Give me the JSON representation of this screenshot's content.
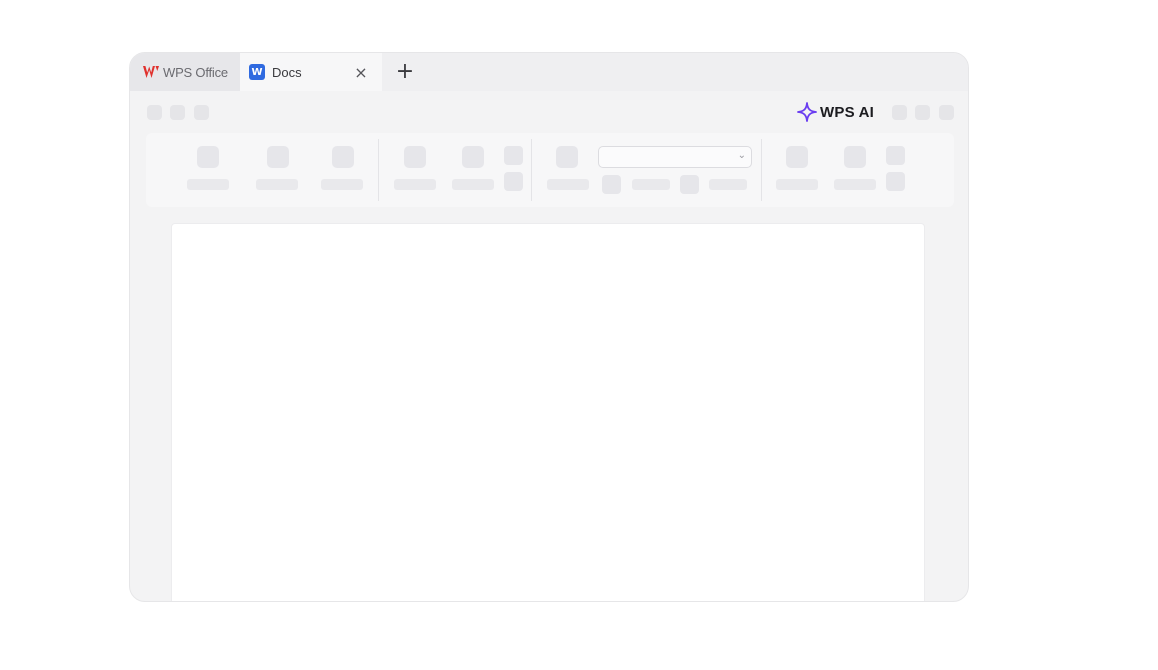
{
  "tabs": {
    "home_label": "WPS Office",
    "doc_label": "Docs",
    "doc_icon_letter": "W",
    "close_glyph": "×",
    "add_glyph": "+"
  },
  "toolbar": {
    "ai_label": "WPS AI"
  },
  "ribbon": {
    "select_chevron": "⌄"
  },
  "colors": {
    "brand_red": "#e0312d",
    "doc_blue": "#2f6ae0",
    "ai_purple": "#6a3df0"
  },
  "icons": {
    "home": "wps-logo-icon",
    "doc": "word-doc-icon",
    "ai": "sparkle-icon",
    "close": "close-icon",
    "add": "plus-icon"
  }
}
